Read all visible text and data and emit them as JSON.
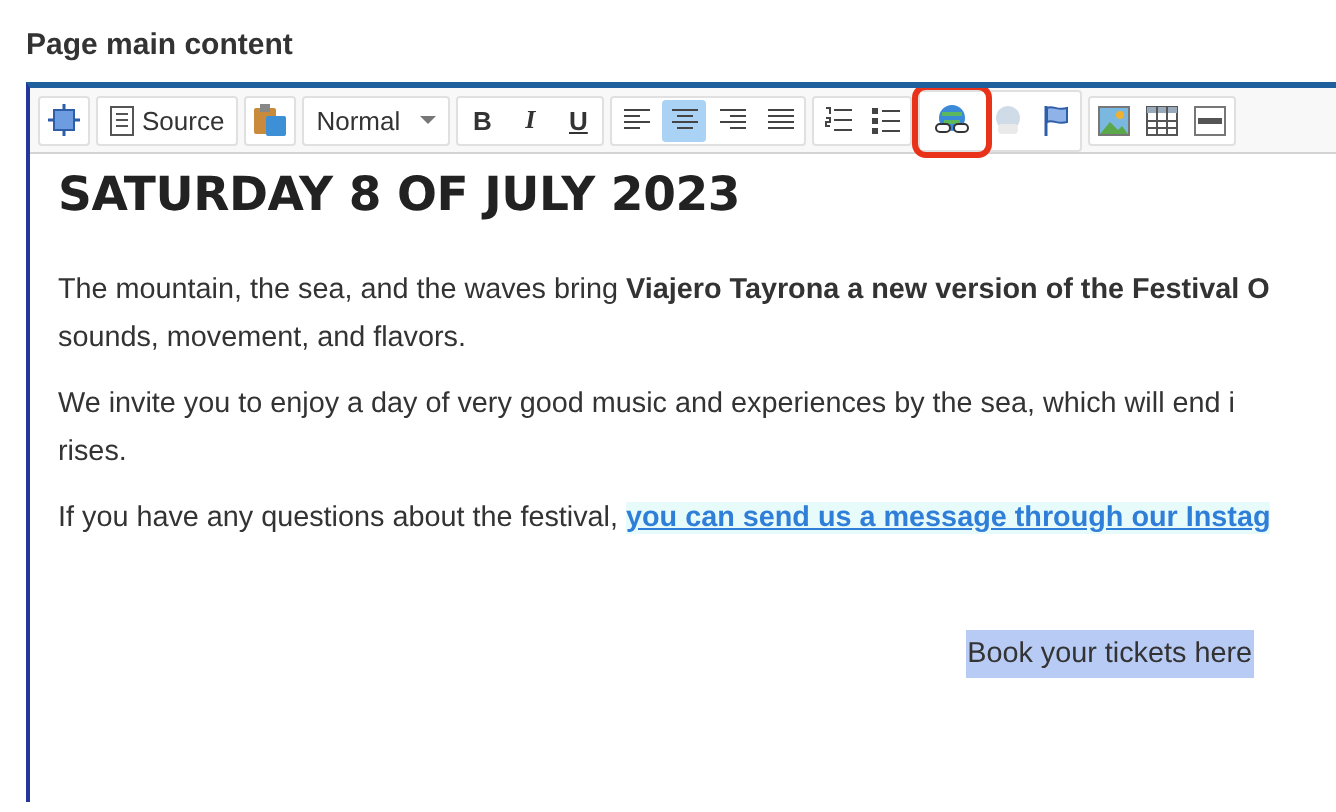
{
  "field_label": "Page main content",
  "toolbar": [
    {
      "tools": [
        {
          "kind": "maximize",
          "selected": false,
          "disabled": false,
          "highlighted": false
        }
      ]
    },
    {
      "tools": [
        {
          "kind": "source",
          "label": "Source",
          "selected": false,
          "disabled": false,
          "highlighted": false
        }
      ]
    },
    {
      "tools": [
        {
          "kind": "paste",
          "selected": false,
          "disabled": false,
          "highlighted": false
        }
      ]
    },
    {
      "tools": [
        {
          "kind": "format",
          "value": "Normal",
          "selected": false,
          "disabled": false,
          "highlighted": false
        }
      ]
    },
    {
      "tools": [
        {
          "kind": "bold",
          "label": "B",
          "selected": false,
          "disabled": false,
          "highlighted": false
        },
        {
          "kind": "italic",
          "label": "I",
          "selected": false,
          "disabled": false,
          "highlighted": false
        },
        {
          "kind": "underline",
          "label": "U",
          "selected": false,
          "disabled": false,
          "highlighted": false
        }
      ]
    },
    {
      "tools": [
        {
          "kind": "align-left",
          "selected": false,
          "disabled": false,
          "highlighted": false
        },
        {
          "kind": "align-center",
          "selected": true,
          "disabled": false,
          "highlighted": false
        },
        {
          "kind": "align-right",
          "selected": false,
          "disabled": false,
          "highlighted": false
        },
        {
          "kind": "justify",
          "selected": false,
          "disabled": false,
          "highlighted": false
        }
      ]
    },
    {
      "tools": [
        {
          "kind": "numbered-list",
          "selected": false,
          "disabled": false,
          "highlighted": false
        },
        {
          "kind": "bullet-list",
          "selected": false,
          "disabled": false,
          "highlighted": false
        }
      ]
    },
    {
      "tools": [
        {
          "kind": "link",
          "selected": false,
          "disabled": false,
          "highlighted": true
        },
        {
          "kind": "unlink",
          "selected": false,
          "disabled": true,
          "highlighted": false
        },
        {
          "kind": "anchor",
          "selected": false,
          "disabled": false,
          "highlighted": false
        }
      ]
    },
    {
      "tools": [
        {
          "kind": "image",
          "selected": false,
          "disabled": false,
          "highlighted": false
        },
        {
          "kind": "table",
          "selected": false,
          "disabled": false,
          "highlighted": false
        },
        {
          "kind": "horizontal-rule",
          "selected": false,
          "disabled": false,
          "highlighted": false
        }
      ]
    }
  ],
  "content": {
    "heading": "SATURDAY 8 OF JULY 2023",
    "paragraphs": [
      {
        "lines": [
          "The mountain, the sea, and the waves bring **Viajero Tayrona a new version of the Festival O**",
          "sounds, movement, and flavors."
        ]
      },
      {
        "lines": [
          "We invite you to enjoy a day of very good music and experiences by the sea, which will end i",
          "rises."
        ]
      },
      {
        "lines": [
          "If you have any questions about the festival,"
        ],
        "link": "you can send us a message through our Instag"
      }
    ],
    "selected_text": "Book your tickets here"
  }
}
